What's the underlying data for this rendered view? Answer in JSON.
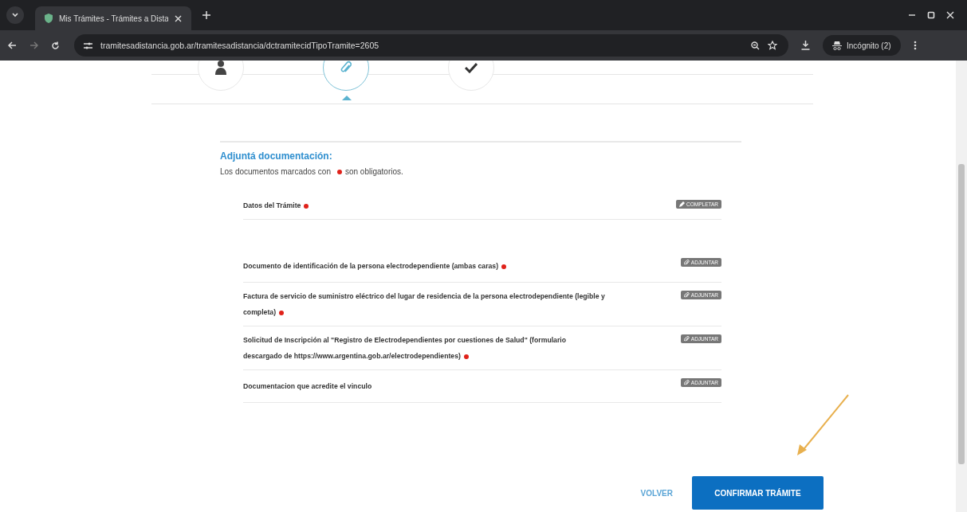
{
  "browser": {
    "tab_title": "Mis Trámites - Trámites a Dista",
    "url": "tramitesadistancia.gob.ar/tramitesadistancia/dctramitecidTipoTramite=2605",
    "profile": "Incógnito (2)"
  },
  "steps": [
    {
      "kind": "person",
      "selected": false
    },
    {
      "kind": "attach",
      "selected": true
    },
    {
      "kind": "check",
      "selected": false
    }
  ],
  "section": {
    "title": "Adjuntá documentación:",
    "note_before": "Los documentos marcados con",
    "note_after": "son obligatorios."
  },
  "documents": [
    {
      "label": "Datos del Trámite",
      "required": true,
      "kind": "complete",
      "action_label": "COMPLETAR"
    },
    {
      "label": "Documento de identificación de la persona electrodependiente (ambas caras)",
      "required": true,
      "kind": "attach",
      "action_label": "ADJUNTAR"
    },
    {
      "label": "Factura de servicio de suministro eléctrico del lugar de residencia de la persona electrodependiente (legible y completa)",
      "required": true,
      "kind": "attach",
      "action_label": "ADJUNTAR"
    },
    {
      "label": "Solicitud de Inscripción al \"Registro de Electrodependientes por cuestiones de Salud\" (formulario descargado de https://www.argentina.gob.ar/electrodependientes)",
      "required": true,
      "kind": "attach",
      "action_label": "ADJUNTAR"
    },
    {
      "label": "Documentacion que acredite el vinculo",
      "required": false,
      "kind": "attach",
      "action_label": "ADJUNTAR"
    }
  ],
  "footer": {
    "back": "VOLVER",
    "confirm": "CONFIRMAR TRÁMITE"
  },
  "annotation": {
    "kind": "arrow"
  }
}
